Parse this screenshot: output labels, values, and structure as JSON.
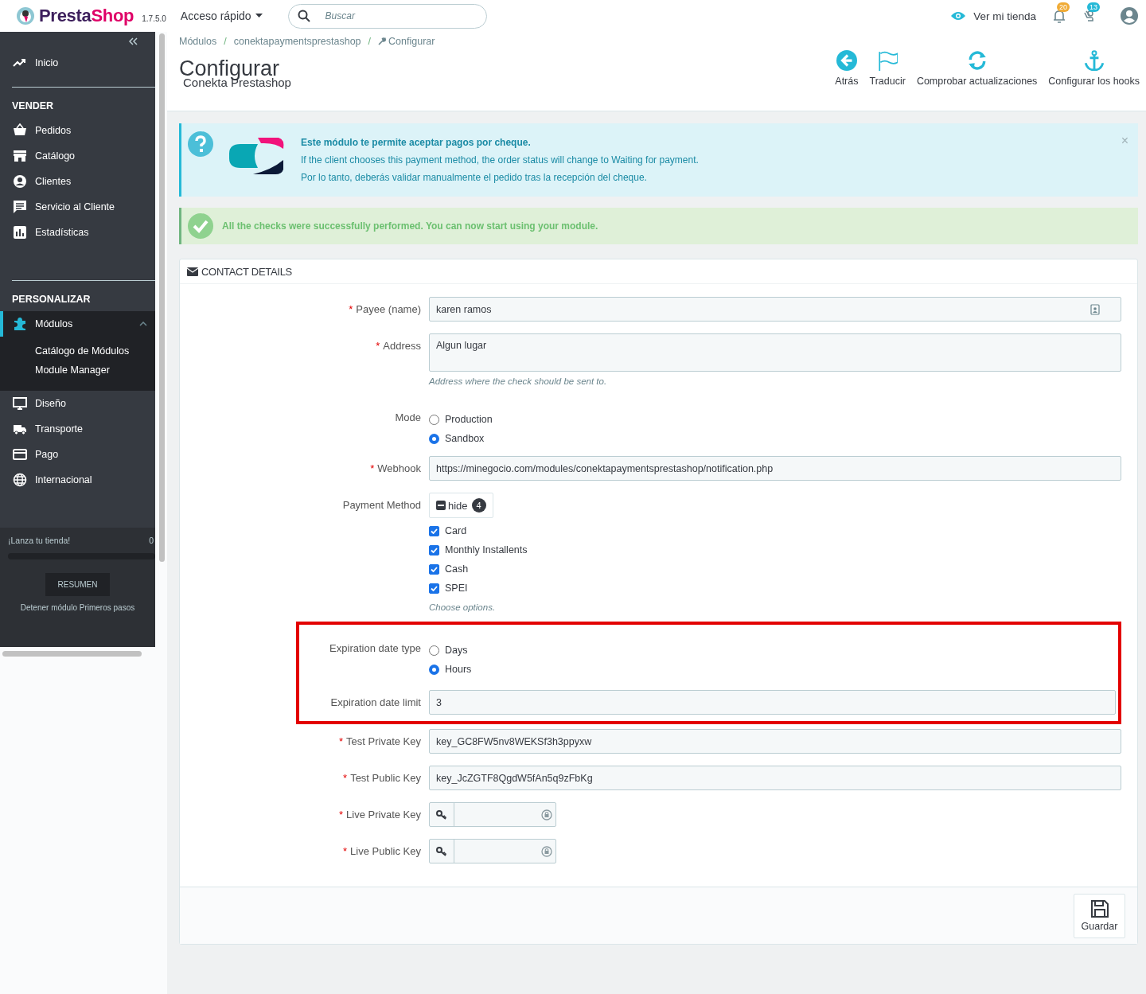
{
  "topbar": {
    "logo": {
      "name_dark": "Presta",
      "name_accent": "Shop"
    },
    "version": "1.7.5.0",
    "quick_access": "Acceso rápido",
    "search": {
      "placeholder": "Buscar"
    },
    "view_store": "Ver mi tienda",
    "notifications": [
      {
        "count": "20",
        "color": "#f0ab36"
      },
      {
        "count": "13",
        "color": "#25b9d7"
      }
    ]
  },
  "sidebar": {
    "sections": [
      {
        "items": [
          {
            "label": "Inicio",
            "selected": false
          }
        ]
      },
      {
        "title": "VENDER",
        "items": [
          {
            "label": "Pedidos",
            "selected": false
          },
          {
            "label": "Catálogo",
            "selected": false
          },
          {
            "label": "Clientes",
            "selected": false
          },
          {
            "label": "Servicio al Cliente",
            "selected": false
          },
          {
            "label": "Estadísticas",
            "selected": false
          }
        ]
      },
      {
        "title": "PERSONALIZAR",
        "items": [
          {
            "label": "Módulos",
            "selected": true,
            "expanded": true,
            "children": [
              {
                "label": "Catálogo de Módulos"
              },
              {
                "label": "Module Manager"
              }
            ]
          },
          {
            "label": "Diseño",
            "selected": false
          },
          {
            "label": "Transporte",
            "selected": false
          },
          {
            "label": "Pago",
            "selected": false
          },
          {
            "label": "Internacional",
            "selected": false
          }
        ]
      }
    ],
    "onboarding": {
      "title": "¡Lanza tu tienda!",
      "percent": "0",
      "level": 0,
      "button": "RESUMEN",
      "stop_link": "Detener módulo Primeros pasos"
    }
  },
  "header": {
    "breadcrumb": [
      "Módulos",
      "conektapaymentsprestashop",
      "Configurar"
    ],
    "breadcrumb_separator": "/",
    "title": "Configurar",
    "subtitle": "Conekta Prestashop",
    "toolbar": [
      "Atrás",
      "Traducir",
      "Comprobar actualizaciones",
      "Configurar los hooks"
    ]
  },
  "alerts": [
    {
      "kind": "info",
      "lines": [
        "Este módulo te permite aceptar pagos por cheque.",
        "If the client chooses this payment method, the order status will change to Waiting for payment.",
        "Por lo tanto, deberás validar manualmente el pedido tras la recepción del cheque."
      ],
      "close": "×"
    },
    {
      "kind": "success",
      "lines": [
        "All the checks were successfully performed. You can now start using your module."
      ]
    }
  ],
  "panel": {
    "title": "CONTACT DETAILS",
    "required_mark": "*",
    "fields": [
      {
        "kind": "text",
        "label": "Payee (name)",
        "required": true,
        "value": "karen ramos",
        "highlighted": false
      },
      {
        "kind": "textarea",
        "label": "Address",
        "required": true,
        "value": "Algun lugar",
        "help": "Address where the check should be sent to.",
        "highlighted": false
      },
      {
        "kind": "radio",
        "label": "Mode",
        "required": false,
        "highlighted": false,
        "options": [
          {
            "label": "Production",
            "selected": false
          },
          {
            "label": "Sandbox",
            "selected": true
          }
        ]
      },
      {
        "kind": "text",
        "label": "Webhook",
        "required": true,
        "value": "https://minegocio.com/modules/conektapaymentsprestashop/notification.php",
        "highlighted": false
      },
      {
        "kind": "checklist",
        "label": "Payment Method",
        "required": false,
        "toggle": "hide",
        "count": "4",
        "help": "Choose options.",
        "highlighted": false,
        "options": [
          {
            "label": "Card",
            "checked": true
          },
          {
            "label": "Monthly Installents",
            "checked": true
          },
          {
            "label": "Cash",
            "checked": true
          },
          {
            "label": "SPEI",
            "checked": true
          }
        ]
      },
      {
        "kind": "radio",
        "label": "Expiration date type",
        "required": false,
        "highlighted": true,
        "options": [
          {
            "label": "Days",
            "selected": false
          },
          {
            "label": "Hours",
            "selected": true
          }
        ]
      },
      {
        "kind": "text",
        "label": "Expiration date limit",
        "required": false,
        "value": "3",
        "highlighted": true
      },
      {
        "kind": "text",
        "label": "Test Private Key",
        "required": true,
        "value": "key_GC8FW5nv8WEKSf3h3ppyxw",
        "highlighted": false
      },
      {
        "kind": "text",
        "label": "Test Public Key",
        "required": true,
        "value": "key_JcZGTF8QgdW5fAn5q9zFbKg",
        "highlighted": false
      },
      {
        "kind": "password",
        "label": "Live Private Key",
        "required": true,
        "highlighted": false
      },
      {
        "kind": "password",
        "label": "Live Public Key",
        "required": true,
        "highlighted": false
      }
    ],
    "save_button": "Guardar"
  }
}
